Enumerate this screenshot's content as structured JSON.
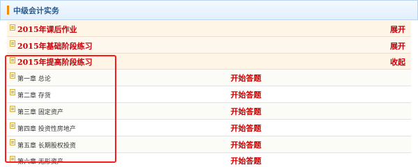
{
  "header": {
    "title": "中级会计实务"
  },
  "sections": [
    {
      "label": "2015年课后作业",
      "action": "展开"
    },
    {
      "label": "2015年基础阶段练习",
      "action": "展开"
    },
    {
      "label": "2015年提高阶段练习",
      "action": "收起"
    }
  ],
  "chapters": [
    {
      "label": "第一章  总论",
      "action": "开始答题"
    },
    {
      "label": "第二章  存货",
      "action": "开始答题"
    },
    {
      "label": "第三章  固定资产",
      "action": "开始答题"
    },
    {
      "label": "第四章  投资性房地产",
      "action": "开始答题"
    },
    {
      "label": "第五章  长期股权投资",
      "action": "开始答题"
    },
    {
      "label": "第六章  无形资产",
      "action": "开始答题"
    }
  ],
  "colors": {
    "accent_red": "#c8000a",
    "header_bar": "#f08a00",
    "highlight_box": "#ff1a1a"
  }
}
